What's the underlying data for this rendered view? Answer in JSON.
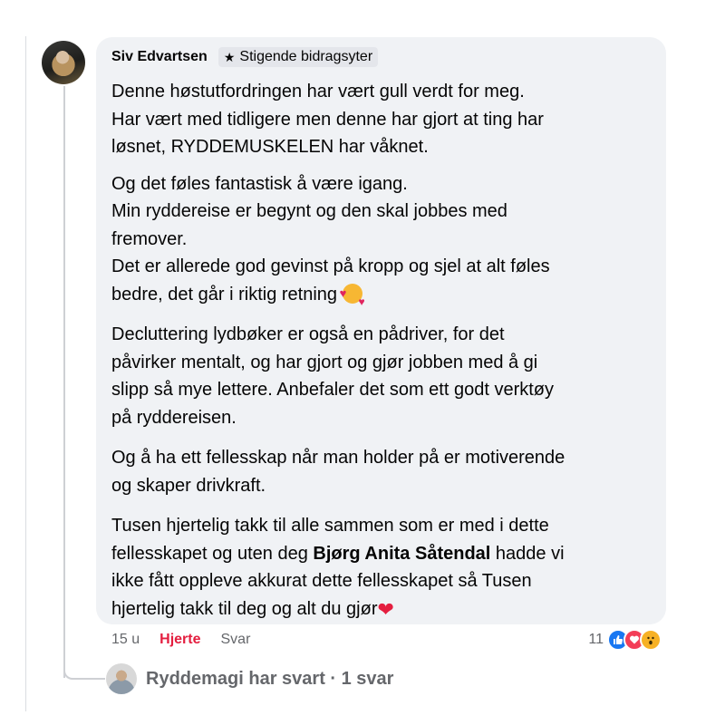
{
  "comment": {
    "author": "Siv Edvartsen",
    "badge_icon": "star-icon",
    "badge_label": "Stigende bidragsyter",
    "paragraph1": [
      "Denne høstutfordringen har vært gull verdt for meg.",
      "Har vært med tidligere men denne har gjort at ting har",
      "løsnet, RYDDEMUSKELEN har våknet."
    ],
    "paragraph2": [
      "Og det føles fantastisk å være igang.",
      "Min ryddereise er begynt og den skal jobbes med",
      "fremover.",
      "Det er allerede god gevinst på kropp og sjel at alt føles",
      "bedre, det går i riktig retning"
    ],
    "paragraph3": [
      "Decluttering lydbøker er også en pådriver, for det",
      "påvirker mentalt, og har gjort og gjør jobben med å gi",
      "slipp så mye lettere. Anbefaler det som ett godt verktøy",
      "på ryddereisen."
    ],
    "paragraph4": [
      "Og å ha ett fellesskap når man holder på er motiverende",
      "og skaper drivkraft."
    ],
    "paragraph5": {
      "line1": "Tusen hjertelig takk til alle sammen som er med i dette",
      "line2_before": "fellesskapet og uten deg ",
      "mention": "Bjørg Anita Såtendal",
      "line2_after": " hadde vi",
      "line3": "ikke fått oppleve akkurat dette fellesskapet så Tusen",
      "line4": "hjertelig takk til deg og alt du gjør",
      "heart": "❤"
    }
  },
  "actions": {
    "time": "15 u",
    "like_label": "Hjerte",
    "reply_label": "Svar"
  },
  "reactions": {
    "count": "11",
    "types": [
      "like",
      "love",
      "wow"
    ]
  },
  "reply_thread": {
    "text": "Ryddemagi har svart · 1 svar"
  }
}
